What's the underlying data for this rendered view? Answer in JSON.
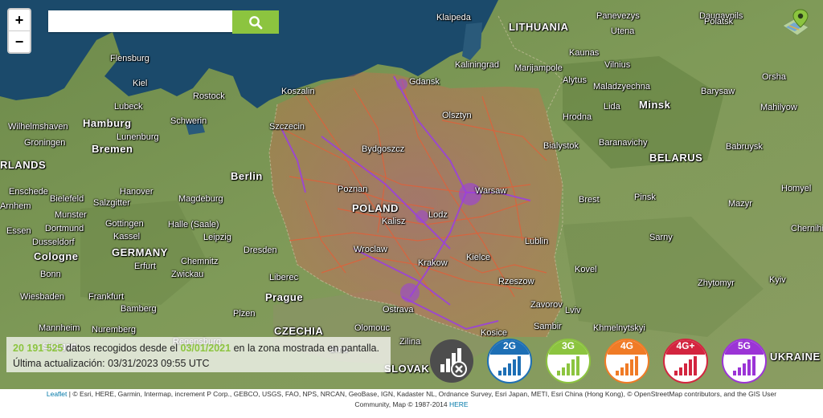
{
  "controls": {
    "zoom_in": "+",
    "zoom_out": "−",
    "search_value": "",
    "search_placeholder": ""
  },
  "map_labels": {
    "cities": [
      {
        "name": "Klaipeda"
      },
      {
        "name": "Panevezys"
      },
      {
        "name": "Daugavpils"
      },
      {
        "name": "Polatsk"
      },
      {
        "name": "Utena"
      },
      {
        "name": "Kaunas"
      },
      {
        "name": "Vilnius"
      },
      {
        "name": "Kaliningrad"
      },
      {
        "name": "Marijampole"
      },
      {
        "name": "Alytus"
      },
      {
        "name": "Maladzyechna"
      },
      {
        "name": "Orsha"
      },
      {
        "name": "Barysaw"
      },
      {
        "name": "Lida"
      },
      {
        "name": "Minsk"
      },
      {
        "name": "Mahilyow"
      },
      {
        "name": "Gdansk"
      },
      {
        "name": "Koszalin"
      },
      {
        "name": "Hrodna"
      },
      {
        "name": "Baranavichy"
      },
      {
        "name": "Babruysk"
      },
      {
        "name": "Bialystok"
      },
      {
        "name": "Olsztyn"
      },
      {
        "name": "Szczecin"
      },
      {
        "name": "Bydgoszcz"
      },
      {
        "name": "Warsaw"
      },
      {
        "name": "Brest"
      },
      {
        "name": "Pinsk"
      },
      {
        "name": "Homyel"
      },
      {
        "name": "Mazyr"
      },
      {
        "name": "Lodz"
      },
      {
        "name": "Lublin"
      },
      {
        "name": "Wroclaw"
      },
      {
        "name": "Sarny"
      },
      {
        "name": "Chernihiv"
      },
      {
        "name": "Kovel"
      },
      {
        "name": "Zhytomyr"
      },
      {
        "name": "Kyiv"
      },
      {
        "name": "Krakow"
      },
      {
        "name": "Rzeszow"
      },
      {
        "name": "Lviv"
      },
      {
        "name": "Khmelnytskyi"
      },
      {
        "name": "Olomouc"
      },
      {
        "name": "Zilina"
      },
      {
        "name": "Kosice"
      },
      {
        "name": "Zavorov"
      },
      {
        "name": "Sambir"
      },
      {
        "name": "Flensburg"
      },
      {
        "name": "Kiel"
      },
      {
        "name": "Rostock"
      },
      {
        "name": "Lubeck"
      },
      {
        "name": "Schwerin"
      },
      {
        "name": "Hamburg"
      },
      {
        "name": "Wilhelmshaven"
      },
      {
        "name": "Bremen"
      },
      {
        "name": "Groningen"
      },
      {
        "name": "Lunenburg"
      },
      {
        "name": "Berlin"
      },
      {
        "name": "Enschede"
      },
      {
        "name": "Bielefeld"
      },
      {
        "name": "Hanover"
      },
      {
        "name": "Magdeburg"
      },
      {
        "name": "Arnhem"
      },
      {
        "name": "Munster"
      },
      {
        "name": "Salzgitter"
      },
      {
        "name": "Essen"
      },
      {
        "name": "Dortmund"
      },
      {
        "name": "Gottingen"
      },
      {
        "name": "Halle (Saale)"
      },
      {
        "name": "Dusseldorf"
      },
      {
        "name": "Kassel"
      },
      {
        "name": "Leipzig"
      },
      {
        "name": "Cologne"
      },
      {
        "name": "Dresden"
      },
      {
        "name": "Chemnitz"
      },
      {
        "name": "Zwickau"
      },
      {
        "name": "Bonn"
      },
      {
        "name": "Erfurt"
      },
      {
        "name": "Liberec"
      },
      {
        "name": "Wiesbaden"
      },
      {
        "name": "Frankfurt"
      },
      {
        "name": "Prague"
      },
      {
        "name": "Bamberg"
      },
      {
        "name": "Mannheim"
      },
      {
        "name": "Nuremberg"
      },
      {
        "name": "Stuttgart"
      },
      {
        "name": "Regensburg"
      },
      {
        "name": "Plzen"
      },
      {
        "name": "Brno"
      },
      {
        "name": "Ostrava"
      },
      {
        "name": "Kielce"
      },
      {
        "name": "Poznan"
      },
      {
        "name": "Kalisz"
      }
    ],
    "regions": [
      {
        "name": "LITHUANIA"
      },
      {
        "name": "BELARUS"
      },
      {
        "name": "POLAND"
      },
      {
        "name": "GERMANY"
      },
      {
        "name": "CZECHIA"
      },
      {
        "name": "SLOVAK"
      },
      {
        "name": "UKRAINE"
      },
      {
        "name": "RLANDS"
      }
    ]
  },
  "info": {
    "count": "20 191 525",
    "text1": "datos recogidos desde el",
    "date": "03/01/2021",
    "text2": "en la zona mostrada en pantalla.",
    "updated": "Última actualización: 03/31/2023 09:55 UTC"
  },
  "tech_buttons": [
    {
      "id": "all",
      "label": "",
      "color": "#555555"
    },
    {
      "id": "2g",
      "label": "2G",
      "color": "#1d6fb5"
    },
    {
      "id": "3g",
      "label": "3G",
      "color": "#8cc43f"
    },
    {
      "id": "4g",
      "label": "4G",
      "color": "#f07b26"
    },
    {
      "id": "4gplus",
      "label": "4G+",
      "color": "#d3253f"
    },
    {
      "id": "5g",
      "label": "5G",
      "color": "#9b34d6"
    }
  ],
  "attribution": {
    "leaflet": "Leaflet",
    "line1": " | © Esri, HERE, Garmin, Intermap, increment P Corp., GEBCO, USGS, FAO, NPS, NRCAN, GeoBase, IGN, Kadaster NL, Ordnance Survey, Esri Japan, METI, Esri China (Hong Kong), © OpenStreetMap contributors, and the GIS User",
    "line2": "Community, Map © 1987-2014 ",
    "here": "HERE"
  }
}
